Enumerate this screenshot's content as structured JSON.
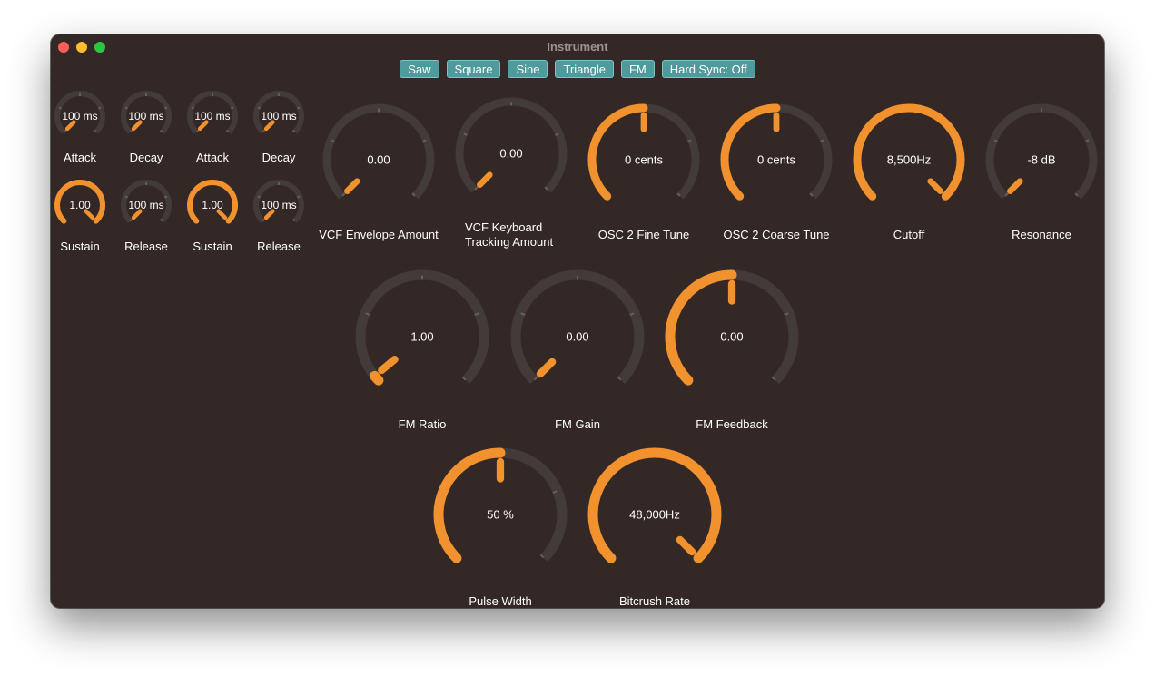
{
  "window": {
    "title": "Instrument"
  },
  "waveform_buttons": [
    {
      "label": "Saw"
    },
    {
      "label": "Square"
    },
    {
      "label": "Sine"
    },
    {
      "label": "Triangle"
    },
    {
      "label": "FM"
    },
    {
      "label": "Hard Sync: Off"
    }
  ],
  "colors": {
    "accent": "#f2922e",
    "track": "#433b39",
    "background": "#332825",
    "button": "#4f9a9c"
  },
  "envelope_knobs": [
    {
      "id": "env1-attack",
      "label": "Attack",
      "value": "100 ms",
      "level": 0.0
    },
    {
      "id": "env1-decay",
      "label": "Decay",
      "value": "100 ms",
      "level": 0.0
    },
    {
      "id": "env2-attack",
      "label": "Attack",
      "value": "100 ms",
      "level": 0.0
    },
    {
      "id": "env2-decay",
      "label": "Decay",
      "value": "100 ms",
      "level": 0.0
    },
    {
      "id": "env1-sustain",
      "label": "Sustain",
      "value": "1.00",
      "level": 1.0
    },
    {
      "id": "env1-release",
      "label": "Release",
      "value": "100 ms",
      "level": 0.0
    },
    {
      "id": "env2-sustain",
      "label": "Sustain",
      "value": "1.00",
      "level": 1.0
    },
    {
      "id": "env2-release",
      "label": "Release",
      "value": "100 ms",
      "level": 0.0
    }
  ],
  "top_knobs": [
    {
      "id": "vcf-envelope-amount",
      "label": "VCF Envelope Amount",
      "value": "0.00",
      "level": 0.0
    },
    {
      "id": "vcf-keyboard-tracking",
      "label": "VCF Keyboard\nTracking Amount",
      "value": "0.00",
      "level": 0.0
    },
    {
      "id": "osc2-fine-tune",
      "label": "OSC 2 Fine Tune",
      "value": "0 cents",
      "level": 0.5
    },
    {
      "id": "osc2-coarse-tune",
      "label": "OSC 2 Coarse Tune",
      "value": "0 cents",
      "level": 0.5
    },
    {
      "id": "cutoff",
      "label": "Cutoff",
      "value": "8,500Hz",
      "level": 1.0
    },
    {
      "id": "resonance",
      "label": "Resonance",
      "value": "-8 dB",
      "level": 0.0
    }
  ],
  "fm_knobs": [
    {
      "id": "fm-ratio",
      "label": "FM Ratio",
      "value": "1.00",
      "level": 0.02
    },
    {
      "id": "fm-gain",
      "label": "FM Gain",
      "value": "0.00",
      "level": 0.0
    },
    {
      "id": "fm-feedback",
      "label": "FM Feedback",
      "value": "0.00",
      "level": 0.5
    }
  ],
  "bottom_knobs": [
    {
      "id": "pulse-width",
      "label": "Pulse Width",
      "value": "50 %",
      "level": 0.5
    },
    {
      "id": "bitcrush-rate",
      "label": "Bitcrush Rate",
      "value": "48,000Hz",
      "level": 1.0
    }
  ]
}
